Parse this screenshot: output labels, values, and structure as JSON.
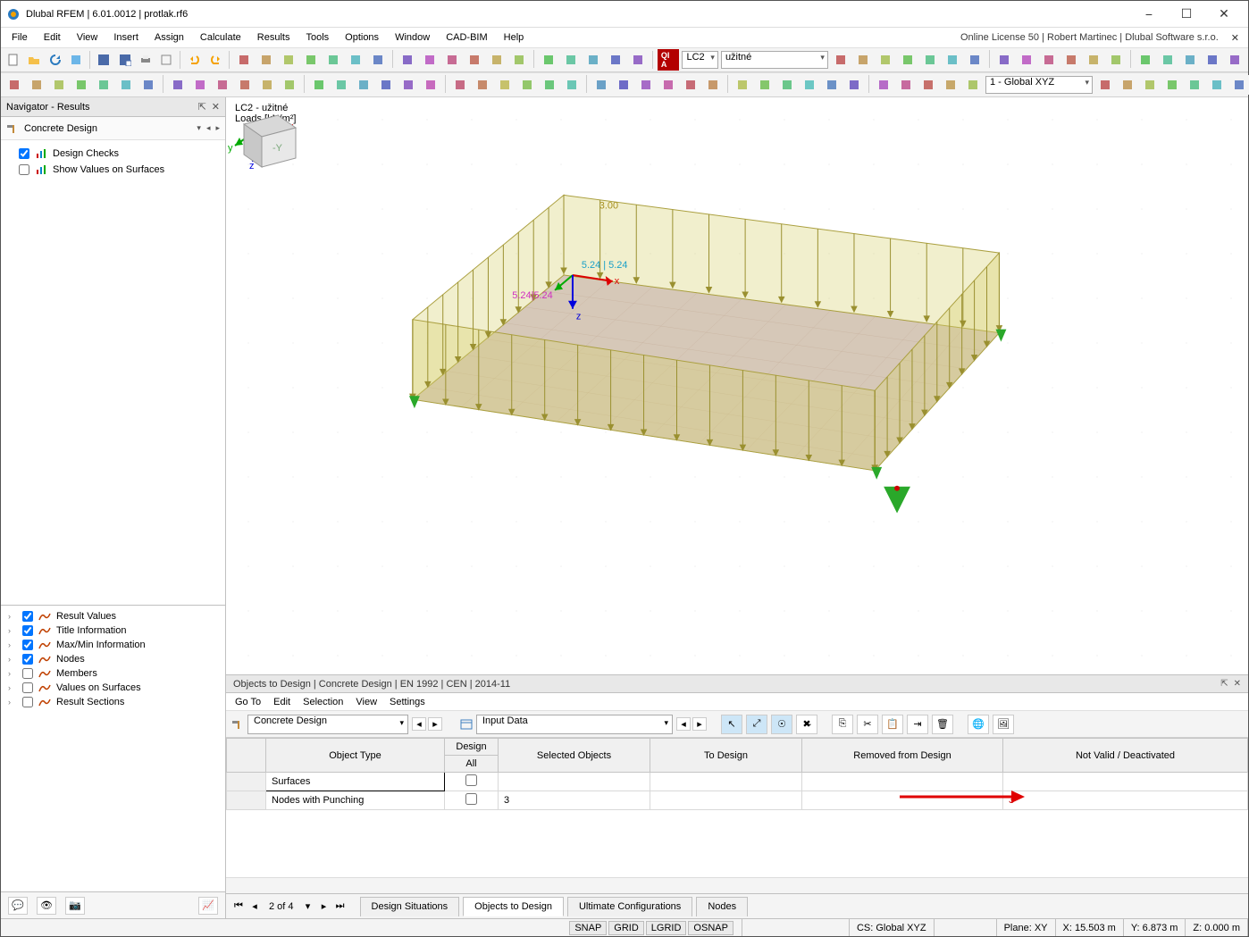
{
  "title": "Dlubal RFEM | 6.01.0012 | protlak.rf6",
  "license_text": "Online License 50 | Robert Martinec | Dlubal Software s.r.o.",
  "menus": [
    "File",
    "Edit",
    "View",
    "Insert",
    "Assign",
    "Calculate",
    "Results",
    "Tools",
    "Options",
    "Window",
    "CAD-BIM",
    "Help"
  ],
  "toolbar1": {
    "loadcase_tag": "QI A",
    "loadcase_id": "LC2",
    "loadcase_name": "užitné"
  },
  "toolbar2": {
    "coord_system": "1 - Global XYZ"
  },
  "navigator": {
    "title": "Navigator - Results",
    "category": "Concrete Design",
    "tree_upper": [
      {
        "label": "Design Checks",
        "checked": true
      },
      {
        "label": "Show Values on Surfaces",
        "checked": false
      }
    ],
    "tree_lower": [
      {
        "label": "Result Values",
        "checked": true
      },
      {
        "label": "Title Information",
        "checked": true
      },
      {
        "label": "Max/Min Information",
        "checked": true
      },
      {
        "label": "Nodes",
        "checked": true
      },
      {
        "label": "Members",
        "checked": false
      },
      {
        "label": "Values on Surfaces",
        "checked": false
      },
      {
        "label": "Result Sections",
        "checked": false
      }
    ]
  },
  "viewport": {
    "loadcase_label": "LC2 - užitné",
    "units_label": "Loads [kN/m²]",
    "load_value": "3.00",
    "annot1": "5.24 | 5.24",
    "annot2": "5.24|5.24",
    "axis_x": "x",
    "axis_y": "y",
    "axis_z": "z",
    "cube_y": "-Y"
  },
  "bottom_panel": {
    "title": "Objects to Design | Concrete Design | EN 1992 | CEN | 2014-11",
    "menus": [
      "Go To",
      "Edit",
      "Selection",
      "View",
      "Settings"
    ],
    "combo_left": "Concrete Design",
    "combo_right": "Input Data",
    "columns": [
      "Object Type",
      "Design All",
      "Selected Objects",
      "To Design",
      "Removed from Design",
      "Not Valid / Deactivated"
    ],
    "rows": [
      {
        "object_type": "Surfaces",
        "design_all": false,
        "selected": "",
        "to_design": "",
        "removed": "",
        "invalid": ""
      },
      {
        "object_type": "Nodes with Punching",
        "design_all": false,
        "selected": "3",
        "to_design": "",
        "removed": "",
        "invalid": "3"
      }
    ],
    "pager_text": "2 of 4",
    "tabs": [
      "Design Situations",
      "Objects to Design",
      "Ultimate Configurations",
      "Nodes"
    ],
    "active_tab": 1
  },
  "statusbar": {
    "snap_buttons": [
      "SNAP",
      "GRID",
      "LGRID",
      "OSNAP"
    ],
    "cs": "CS: Global XYZ",
    "plane": "Plane: XY",
    "x": "X: 15.503 m",
    "y": "Y: 6.873 m",
    "z": "Z: 0.000 m"
  }
}
